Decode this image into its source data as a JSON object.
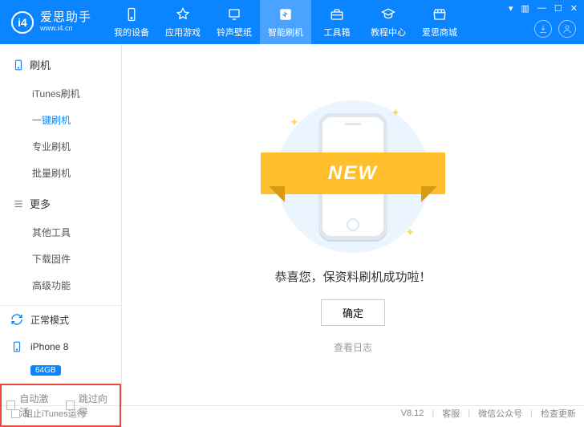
{
  "logo": {
    "badge": "i4",
    "cn": "爱思助手",
    "url": "www.i4.cn"
  },
  "nav": [
    {
      "label": "我的设备",
      "icon": "device"
    },
    {
      "label": "应用游戏",
      "icon": "apps"
    },
    {
      "label": "铃声壁纸",
      "icon": "ringtone"
    },
    {
      "label": "智能刷机",
      "icon": "flash",
      "active": true
    },
    {
      "label": "工具箱",
      "icon": "toolbox"
    },
    {
      "label": "教程中心",
      "icon": "tutorial"
    },
    {
      "label": "爱思商城",
      "icon": "shop"
    }
  ],
  "sidebar": {
    "sections": [
      {
        "title": "刷机",
        "items": [
          "iTunes刷机",
          "一键刷机",
          "专业刷机",
          "批量刷机"
        ],
        "activeIndex": 1
      },
      {
        "title": "更多",
        "items": [
          "其他工具",
          "下载固件",
          "高级功能"
        ],
        "activeIndex": -1
      }
    ],
    "mode": "正常模式",
    "device": {
      "name": "iPhone 8",
      "storage": "64GB"
    },
    "checks": [
      "自动激活",
      "跳过向导"
    ]
  },
  "main": {
    "bannerText": "NEW",
    "success": "恭喜您，保资料刷机成功啦！",
    "ok": "确定",
    "logLink": "查看日志"
  },
  "footer": {
    "blockItunes": "阻止iTunes运行",
    "version": "V8.12",
    "links": [
      "客服",
      "微信公众号",
      "检查更新"
    ]
  }
}
